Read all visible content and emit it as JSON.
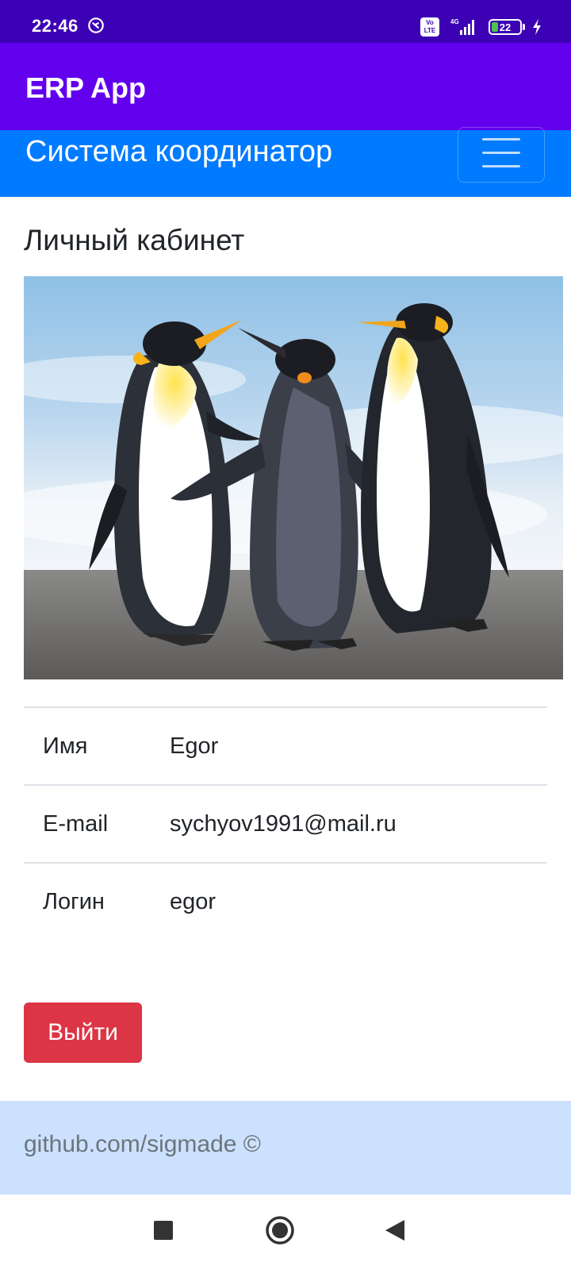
{
  "status_bar": {
    "time": "22:46",
    "network": "4G",
    "volte": "Vo LTE",
    "battery_level": "22",
    "charging": true,
    "colors": {
      "background": "#3c00b5",
      "battery_fill": "#4cc34c"
    }
  },
  "app_bar": {
    "title": "ERP App",
    "color": "#6200ee"
  },
  "navbar": {
    "brand": "Система координатор",
    "toggle_icon": "menu-icon",
    "color": "#007bff"
  },
  "page": {
    "title": "Личный кабинет",
    "photo": {
      "subject": "three king penguins on a beach"
    },
    "profile": [
      {
        "label": "Имя",
        "value": "Egor"
      },
      {
        "label": "E-mail",
        "value": "sychyov1991@mail.ru"
      },
      {
        "label": "Логин",
        "value": "egor"
      }
    ],
    "logout_label": "Выйти",
    "logout_color": "#dc3545"
  },
  "footer": {
    "text": "github.com/sigmade ©",
    "color": "#cce1fd"
  },
  "system_nav": {
    "recents": "square-icon",
    "home": "circle-icon",
    "back": "triangle-icon"
  }
}
